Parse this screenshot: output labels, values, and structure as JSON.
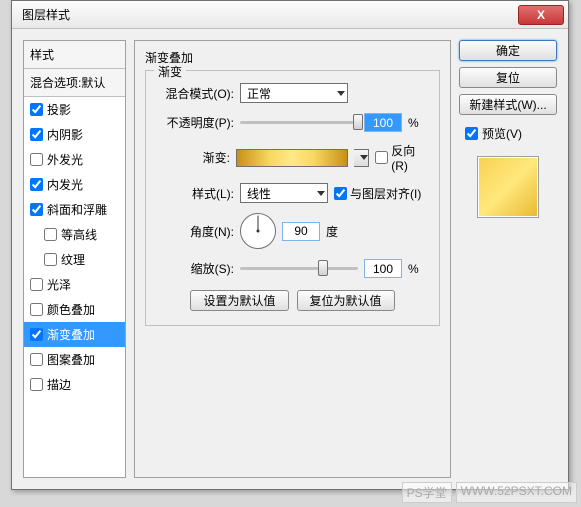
{
  "dialog": {
    "title": "图层样式",
    "close": "X"
  },
  "styles_panel": {
    "header": "样式",
    "blend_header": "混合选项:默认",
    "items": [
      {
        "label": "投影",
        "checked": true,
        "indent": false
      },
      {
        "label": "内阴影",
        "checked": true,
        "indent": false
      },
      {
        "label": "外发光",
        "checked": false,
        "indent": false
      },
      {
        "label": "内发光",
        "checked": true,
        "indent": false
      },
      {
        "label": "斜面和浮雕",
        "checked": true,
        "indent": false
      },
      {
        "label": "等高线",
        "checked": false,
        "indent": true
      },
      {
        "label": "纹理",
        "checked": false,
        "indent": true
      },
      {
        "label": "光泽",
        "checked": false,
        "indent": false
      },
      {
        "label": "颜色叠加",
        "checked": false,
        "indent": false
      },
      {
        "label": "渐变叠加",
        "checked": true,
        "indent": false,
        "selected": true
      },
      {
        "label": "图案叠加",
        "checked": false,
        "indent": false
      },
      {
        "label": "描边",
        "checked": false,
        "indent": false
      }
    ]
  },
  "main": {
    "title": "渐变叠加",
    "fieldset": "渐变",
    "blend_mode_label": "混合模式(O):",
    "blend_mode_value": "正常",
    "opacity_label": "不透明度(P):",
    "opacity_value": "100",
    "opacity_unit": "%",
    "gradient_label": "渐变:",
    "reverse_label": "反向(R)",
    "style_label": "样式(L):",
    "style_value": "线性",
    "align_label": "与图层对齐(I)",
    "angle_label": "角度(N):",
    "angle_value": "90",
    "angle_unit": "度",
    "scale_label": "缩放(S):",
    "scale_value": "100",
    "scale_unit": "%",
    "set_default": "设置为默认值",
    "reset_default": "复位为默认值"
  },
  "right": {
    "ok": "确定",
    "cancel": "复位",
    "new_style": "新建样式(W)...",
    "preview_label": "预览(V)"
  },
  "watermark": {
    "a": "PS学堂",
    "b": "WWW.52PSXT.COM"
  }
}
